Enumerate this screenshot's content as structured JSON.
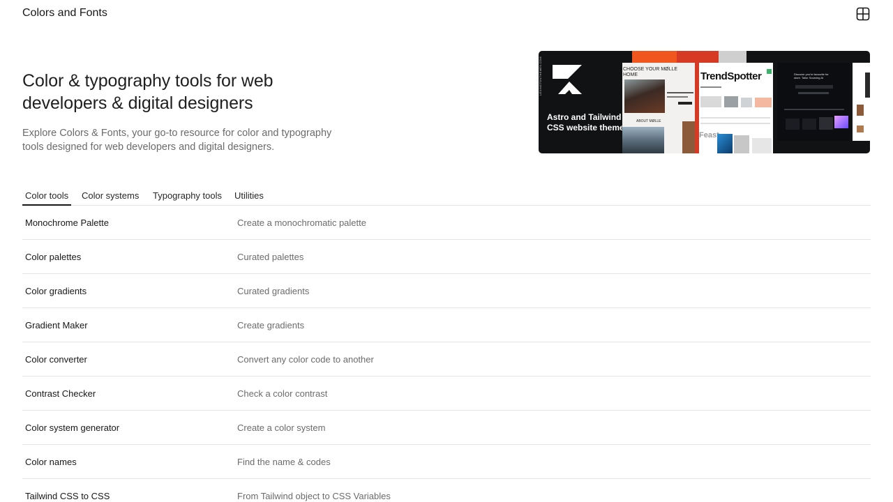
{
  "header": {
    "site_title": "Colors and Fonts",
    "menu_icon": "grid-icon"
  },
  "hero": {
    "heading": "Color & typography tools for web developers & digital designers",
    "description": "Explore Colors & Fonts, your go-to resource for color and typography tools designed for web developers and digital designers."
  },
  "promo": {
    "caption": "Astro  and Tailwind CSS website themes",
    "side_text": "LEXINGTONTHEMES.COM",
    "shots": {
      "molle_heading": "CHOOSE      YOUR MØLLE HOME",
      "molle_sub": "ABOUT MØLLE",
      "trendspotter": "TrendSpotter",
      "feast": "Feast",
      "dark_heading": "Discover you're favourite for store. Tailor Sourcing AI"
    },
    "colors": {
      "orange": "#f0561e",
      "red": "#d63a24",
      "grey": "#cfcfcf",
      "dark": "#111214"
    }
  },
  "tabs": [
    {
      "label": "Color tools",
      "active": true
    },
    {
      "label": "Color systems",
      "active": false
    },
    {
      "label": "Typography tools",
      "active": false
    },
    {
      "label": "Utilities",
      "active": false
    }
  ],
  "tools": [
    {
      "name": "Monochrome Palette",
      "description": "Create a monochromatic palette"
    },
    {
      "name": "Color palettes",
      "description": "Curated palettes"
    },
    {
      "name": "Color gradients",
      "description": "Curated gradients"
    },
    {
      "name": "Gradient Maker",
      "description": "Create gradients"
    },
    {
      "name": "Color converter",
      "description": "Convert any color code to another"
    },
    {
      "name": "Contrast Checker",
      "description": "Check a color contrast"
    },
    {
      "name": "Color system generator",
      "description": "Create a color system"
    },
    {
      "name": "Color names",
      "description": "Find the name & codes"
    },
    {
      "name": "Tailwind CSS to CSS",
      "description": "From Tailwind object to CSS Variables"
    }
  ]
}
